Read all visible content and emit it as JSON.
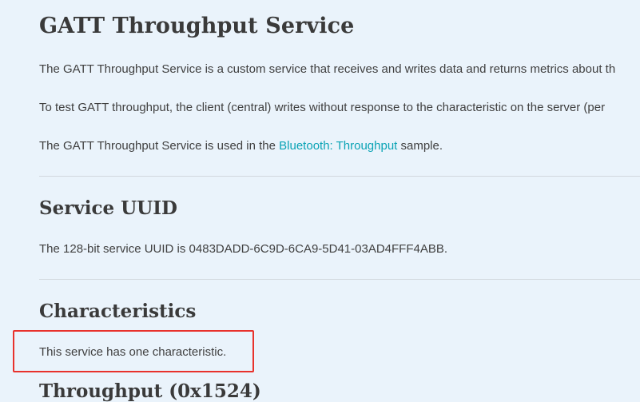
{
  "page": {
    "title": "GATT Throughput Service",
    "intro": {
      "p1": "The GATT Throughput Service is a custom service that receives and writes data and returns metrics about th",
      "p2": "To test GATT throughput, the client (central) writes without response to the characteristic on the server (per",
      "p3_before": "The GATT Throughput Service is used in the ",
      "p3_link": "Bluetooth: Throughput",
      "p3_after": " sample."
    }
  },
  "service_uuid": {
    "heading": "Service UUID",
    "text": "The 128-bit service UUID is 0483DADD-6C9D-6CA9-5D41-03AD4FFF4ABB."
  },
  "characteristics": {
    "heading": "Characteristics",
    "text": "This service has one characteristic.",
    "next_heading_partial": "Throughput (0x1524)"
  },
  "colors": {
    "background": "#eaf3fb",
    "link": "#0aa3b5",
    "highlight_border": "#e8322c"
  }
}
